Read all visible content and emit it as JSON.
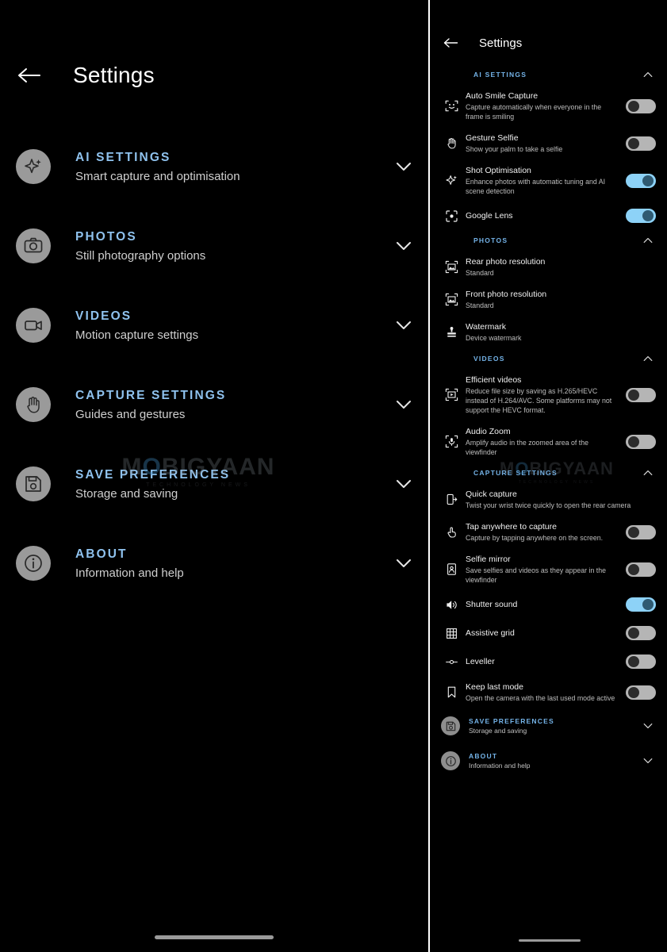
{
  "watermark": {
    "text_main": "M BIGYAAN",
    "text_o": "O",
    "text_sub": "TECHNOLOGY NEWS"
  },
  "left_panel": {
    "back_icon": "arrow-left-icon",
    "title": "Settings",
    "items": [
      {
        "icon": "sparkle-ai-icon",
        "category": "AI SETTINGS",
        "subtitle": "Smart capture and optimisation",
        "chevron": "chevron-down-icon"
      },
      {
        "icon": "camera-icon",
        "category": "PHOTOS",
        "subtitle": "Still photography options",
        "chevron": "chevron-down-icon"
      },
      {
        "icon": "video-camera-icon",
        "category": "VIDEOS",
        "subtitle": "Motion capture settings",
        "chevron": "chevron-down-icon"
      },
      {
        "icon": "hand-palm-icon",
        "category": "CAPTURE SETTINGS",
        "subtitle": "Guides and gestures",
        "chevron": "chevron-down-icon"
      },
      {
        "icon": "floppy-save-icon",
        "category": "SAVE PREFERENCES",
        "subtitle": "Storage and saving",
        "chevron": "chevron-down-icon"
      },
      {
        "icon": "info-circle-icon",
        "category": "ABOUT",
        "subtitle": "Information and help",
        "chevron": "chevron-down-icon"
      }
    ]
  },
  "right_panel": {
    "back_icon": "arrow-left-icon",
    "title": "Settings",
    "sections": [
      {
        "label": "AI SETTINGS",
        "chevron": "chevron-up-icon",
        "rows": [
          {
            "icon": "smile-face-scan-icon",
            "name": "Auto Smile Capture",
            "desc": "Capture automatically when everyone in the frame is smiling",
            "control": "toggle",
            "state": "off"
          },
          {
            "icon": "hand-palm-icon",
            "name": "Gesture Selfie",
            "desc": "Show your palm to take a selfie",
            "control": "toggle",
            "state": "off"
          },
          {
            "icon": "sparkle-ai-icon",
            "name": "Shot Optimisation",
            "desc": "Enhance photos with automatic tuning and AI scene detection",
            "control": "toggle",
            "state": "on"
          },
          {
            "icon": "google-lens-icon",
            "name": "Google Lens",
            "desc": "",
            "control": "toggle",
            "state": "on"
          }
        ]
      },
      {
        "label": "PHOTOS",
        "chevron": "chevron-up-icon",
        "rows": [
          {
            "icon": "photo-frame-icon",
            "name": "Rear photo resolution",
            "value": "Standard",
            "control": "none"
          },
          {
            "icon": "photo-frame-icon",
            "name": "Front photo resolution",
            "value": "Standard",
            "control": "none"
          },
          {
            "icon": "stamp-watermark-icon",
            "name": "Watermark",
            "value": "Device watermark",
            "control": "none"
          }
        ]
      },
      {
        "label": "VIDEOS",
        "chevron": "chevron-up-icon",
        "rows": [
          {
            "icon": "video-frame-icon",
            "name": "Efficient videos",
            "desc": "Reduce file size by saving as H.265/HEVC instead of H.264/AVC. Some platforms may not support the HEVC format.",
            "control": "toggle",
            "state": "off"
          },
          {
            "icon": "audio-zoom-icon",
            "name": "Audio Zoom",
            "desc": "Amplify audio in the zoomed area of the viewfinder",
            "control": "toggle",
            "state": "off"
          }
        ]
      },
      {
        "label": "CAPTURE SETTINGS",
        "chevron": "chevron-up-icon",
        "rows": [
          {
            "icon": "phone-twist-icon",
            "name": "Quick capture",
            "desc": "Twist your wrist twice quickly to open the rear camera",
            "control": "none"
          },
          {
            "icon": "tap-finger-icon",
            "name": "Tap anywhere to capture",
            "desc": "Capture by tapping anywhere on the screen.",
            "control": "toggle",
            "state": "off"
          },
          {
            "icon": "selfie-mirror-icon",
            "name": "Selfie mirror",
            "desc": "Save selfies and videos as they appear in the viewfinder",
            "control": "toggle",
            "state": "off"
          },
          {
            "icon": "speaker-sound-icon",
            "name": "Shutter sound",
            "desc": "",
            "control": "toggle",
            "state": "on"
          },
          {
            "icon": "grid-icon",
            "name": "Assistive grid",
            "desc": "",
            "control": "toggle",
            "state": "off"
          },
          {
            "icon": "leveller-icon",
            "name": "Leveller",
            "desc": "",
            "control": "toggle",
            "state": "off"
          },
          {
            "icon": "bookmark-icon",
            "name": "Keep last mode",
            "desc": "Open the camera with the last used mode active",
            "control": "toggle",
            "state": "off"
          }
        ]
      }
    ],
    "collapsed": [
      {
        "icon": "floppy-save-icon",
        "category": "SAVE PREFERENCES",
        "subtitle": "Storage and saving",
        "chevron": "chevron-down-icon"
      },
      {
        "icon": "info-circle-icon",
        "category": "ABOUT",
        "subtitle": "Information and help",
        "chevron": "chevron-down-icon"
      }
    ]
  }
}
